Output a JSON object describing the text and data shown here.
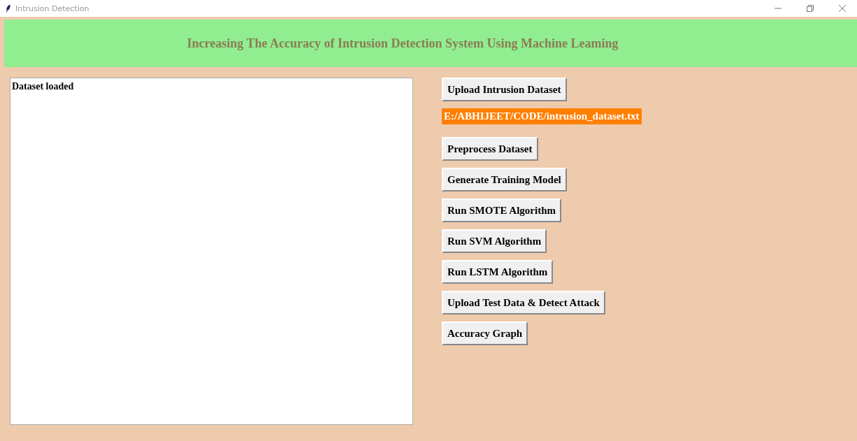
{
  "window": {
    "title": "Intrusion Detection"
  },
  "banner": {
    "title": "Increasing The Accuracy of Intrusion Detection System Using Machine Leaming"
  },
  "output": {
    "text": "Dataset loaded"
  },
  "controls": [
    {
      "kind": "button",
      "label": "Upload Intrusion Dataset"
    },
    {
      "kind": "path",
      "label": "E:/ABHIJEET/CODE/intrusion_dataset.txt"
    },
    {
      "kind": "button",
      "label": "Preprocess Dataset"
    },
    {
      "kind": "button",
      "label": "Generate Training Model"
    },
    {
      "kind": "button",
      "label": "Run SMOTE Algorithm"
    },
    {
      "kind": "button",
      "label": "Run SVM Algorithm"
    },
    {
      "kind": "button",
      "label": "Run LSTM Algorithm"
    },
    {
      "kind": "button",
      "label": "Upload Test Data & Detect Attack"
    },
    {
      "kind": "button",
      "label": "Accuracy Graph"
    }
  ]
}
